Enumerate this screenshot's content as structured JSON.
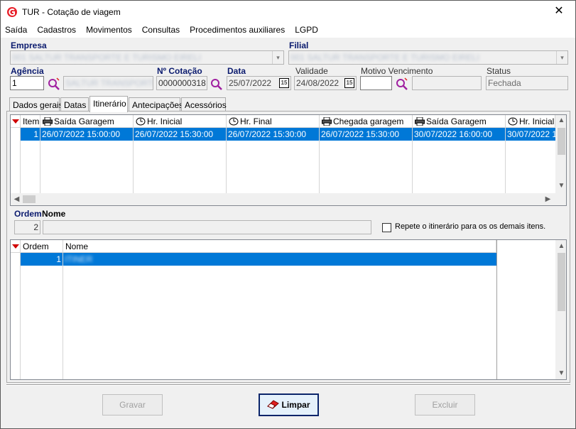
{
  "window": {
    "title": "TUR - Cotação de viagem",
    "close_glyph": "✕"
  },
  "menu": [
    "Saída",
    "Cadastros",
    "Movimentos",
    "Consultas",
    "Procedimentos auxiliares",
    "LGPD"
  ],
  "form": {
    "empresa_label": "Empresa",
    "empresa_value": "001 SALTUR TRANSPORTE E TURISMO EIRELI",
    "filial_label": "Filial",
    "filial_value": "001 SALTUR TRANSPORTE E TURISMO EIRELI",
    "agencia_label": "Agência",
    "agencia_code": "1",
    "agencia_name": "SALTUR TRANSPORTE E",
    "cotacao_label": "Nº Cotação",
    "cotacao_value": "0000000318",
    "data_label": "Data",
    "data_value": "25/07/2022",
    "validade_label": "Validade",
    "validade_value": "24/08/2022",
    "motivo_label": "Motivo Vencimento",
    "motivo_code": "",
    "motivo_desc": "",
    "status_label": "Status",
    "status_value": "Fechada",
    "cal_glyph": "15"
  },
  "tabs": [
    "Dados gerais",
    "Datas",
    "Itinerário",
    "Antecipações",
    "Acessórios"
  ],
  "itinerary_grid": {
    "columns": [
      "Item",
      "Saída Garagem",
      "Hr. Inicial",
      "Hr. Final",
      "Chegada garagem",
      "Saída Garagem",
      "Hr. Inicial"
    ],
    "rows": [
      [
        "1",
        "26/07/2022 15:00:00",
        "26/07/2022 15:30:00",
        "26/07/2022 15:30:00",
        "26/07/2022 15:30:00",
        "30/07/2022 16:00:00",
        "30/07/2022 1"
      ]
    ]
  },
  "order_section": {
    "ordem_label": "Ordem",
    "nome_label": "Nome",
    "ordem_value": "2",
    "nome_value": "",
    "repeat_label": "Repete o itinerário para os os demais itens."
  },
  "names_grid": {
    "columns": [
      "Ordem",
      "Nome"
    ],
    "rows": [
      [
        "1",
        "ITINER"
      ]
    ]
  },
  "buttons": {
    "gravar": "Gravar",
    "limpar": "Limpar",
    "excluir": "Excluir"
  },
  "colors": {
    "selection": "#0078d7",
    "label_blue": "#0a1a6e",
    "search_icon": "#a020a0"
  }
}
